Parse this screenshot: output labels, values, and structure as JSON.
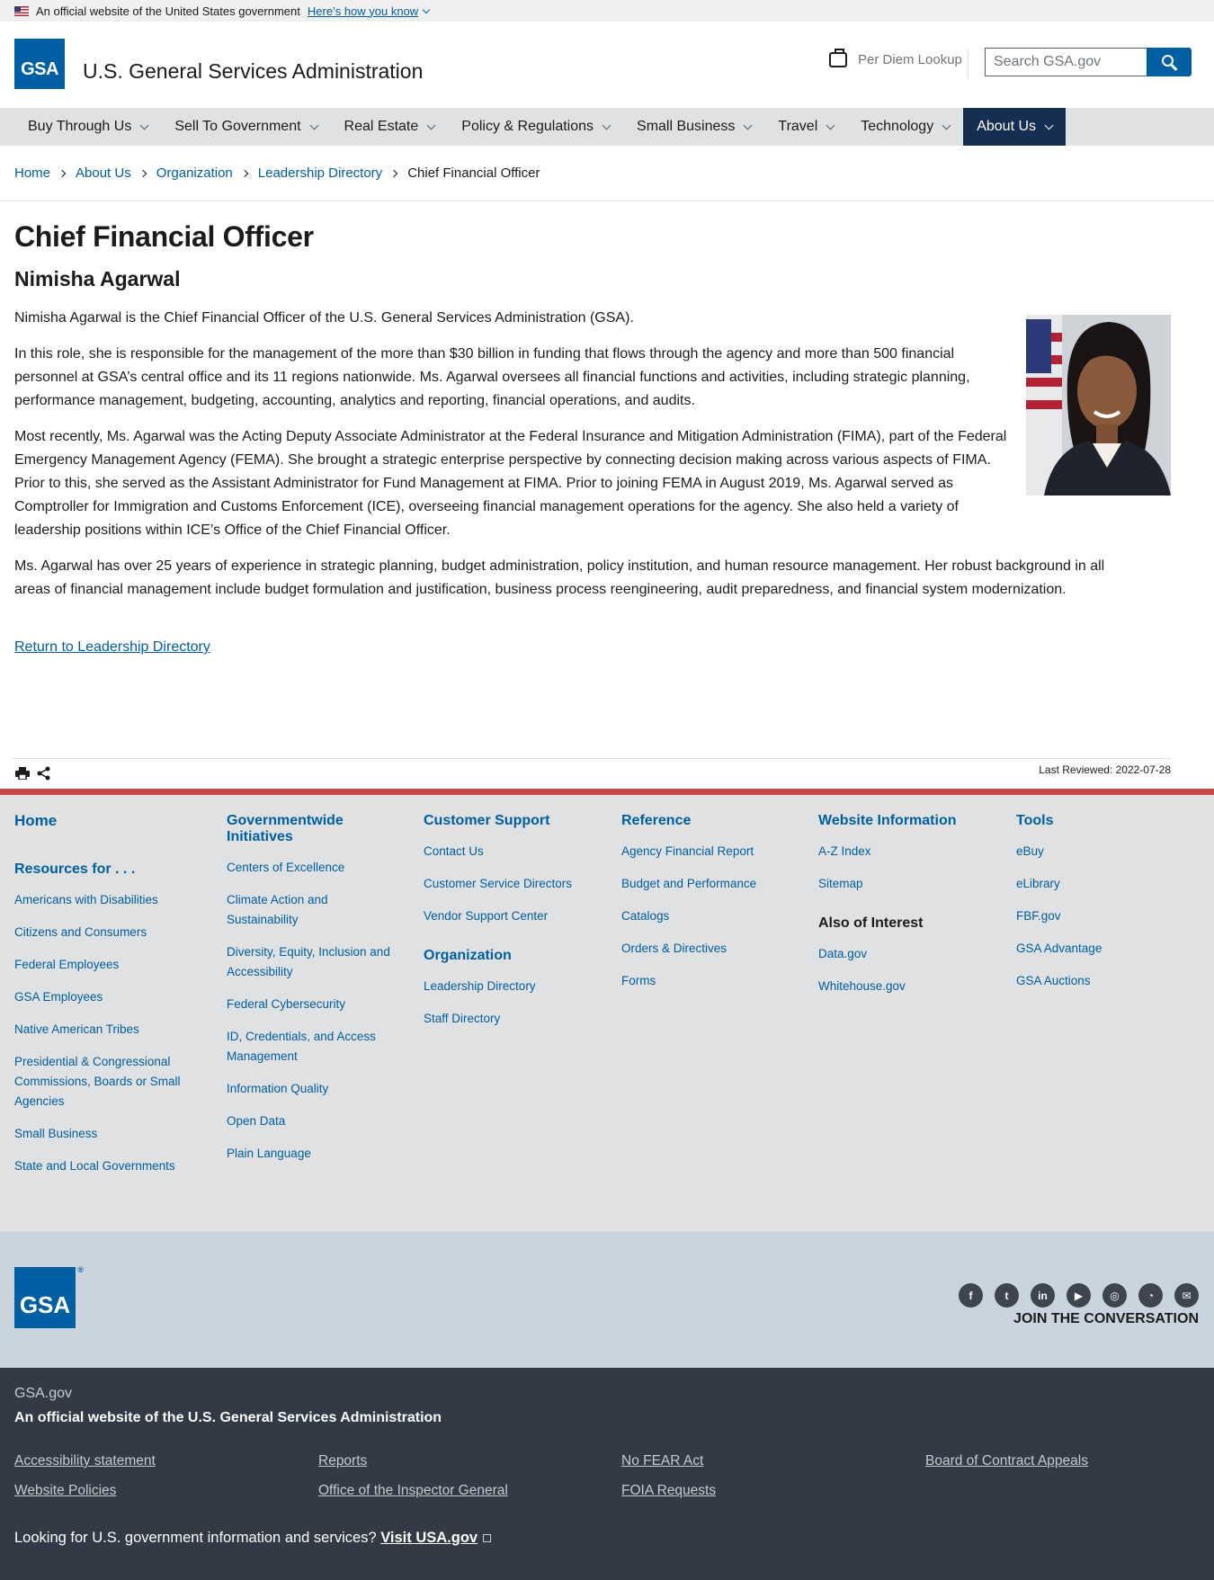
{
  "gov_banner": {
    "text": "An official website of the United States government",
    "link": "Here’s how you know"
  },
  "header": {
    "logo_text": "GSA",
    "title": "U.S. General Services Administration",
    "per_diem": "Per Diem Lookup",
    "search_placeholder": "Search GSA.gov"
  },
  "nav": [
    "Buy Through Us",
    "Sell To Government",
    "Real Estate",
    "Policy & Regulations",
    "Small Business",
    "Travel",
    "Technology",
    "About Us"
  ],
  "breadcrumb": [
    "Home",
    "About Us",
    "Organization",
    "Leadership Directory",
    "Chief Financial Officer"
  ],
  "main": {
    "title": "Chief Financial Officer",
    "name": "Nimisha Agarwal",
    "paragraphs": [
      "Nimisha Agarwal is the Chief Financial Officer of the U.S. General Services Administration (GSA).",
      "In this role, she is responsible for the management of the more than $30 billion in funding that flows through the agency and more than 500 financial personnel at GSA’s central office and its 11 regions nationwide. Ms. Agarwal oversees all financial functions and activities, including strategic planning, performance management, budgeting, accounting, analytics and reporting, financial operations, and audits.",
      "Most recently, Ms. Agarwal was the Acting Deputy Associate Administrator at the Federal Insurance and Mitigation Administration (FIMA), part of the Federal Emergency Management Agency (FEMA). She brought a strategic enterprise perspective by connecting decision making across various aspects of FIMA. Prior to this, she served as the Assistant Administrator for Fund Management at FIMA. Prior to joining FEMA in August 2019, Ms. Agarwal served as Comptroller for Immigration and Customs Enforcement (ICE), overseeing financial management operations for the agency. She also held a variety of leadership positions within ICE’s Office of the Chief Financial Officer.",
      "Ms. Agarwal has over 25 years of experience in strategic planning, budget administration, policy institution, and human resource management. Her robust background in all areas of financial management include budget formulation and justification, business process reengineering, audit preparedness, and financial system modernization."
    ],
    "return_link": "Return to Leadership Directory",
    "last_reviewed": "Last Reviewed: 2022-07-28"
  },
  "footer": {
    "home": "Home",
    "resources_heading": "Resources for . . .",
    "resources": [
      "Americans with Disabilities",
      "Citizens and Consumers",
      "Federal Employees",
      "GSA Employees",
      "Native American Tribes",
      "Presidential & Congressional Commissions, Boards or Small Agencies",
      "Small Business",
      "State and Local Governments"
    ],
    "gov_heading": "Governmentwide Initiatives",
    "gov": [
      "Centers of Excellence",
      "Climate Action and Sustainability",
      "Diversity, Equity, Inclusion and Accessibility",
      "Federal Cybersecurity",
      "ID, Credentials, and Access Management",
      "Information Quality",
      "Open Data",
      "Plain Language"
    ],
    "support_heading": "Customer Support",
    "support": [
      "Contact Us",
      "Customer Service Directors",
      "Vendor Support Center"
    ],
    "org_heading": "Organization",
    "org": [
      "Leadership Directory",
      "Staff Directory"
    ],
    "reference_heading": "Reference",
    "reference": [
      "Agency Financial Report",
      "Budget and Performance",
      "Catalogs",
      "Orders & Directives",
      "Forms"
    ],
    "website_heading": "Website Information",
    "website": [
      "A-Z Index",
      "Sitemap"
    ],
    "interest_heading": "Also of Interest",
    "interest": [
      "Data.gov",
      "Whitehouse.gov"
    ],
    "tools_heading": "Tools",
    "tools": [
      "eBuy",
      "eLibrary",
      "FBF.gov",
      "GSA Advantage",
      "GSA Auctions"
    ],
    "join": "JOIN THE CONVERSATION",
    "social_icons": [
      "facebook-icon",
      "twitter-icon",
      "linkedin-icon",
      "youtube-icon",
      "instagram-icon",
      "blog-icon",
      "email-icon"
    ]
  },
  "identifier": {
    "domain": "GSA.gov",
    "official": "An official website of the U.S. General Services Administration",
    "links": [
      "Accessibility statement",
      "Reports",
      "No FEAR Act",
      "Board of Contract Appeals",
      "Website Policies",
      "Office of the Inspector General",
      "FOIA Requests"
    ],
    "usa_prefix": "Looking for U.S. government information and services?",
    "usa_link": "Visit USA.gov"
  }
}
